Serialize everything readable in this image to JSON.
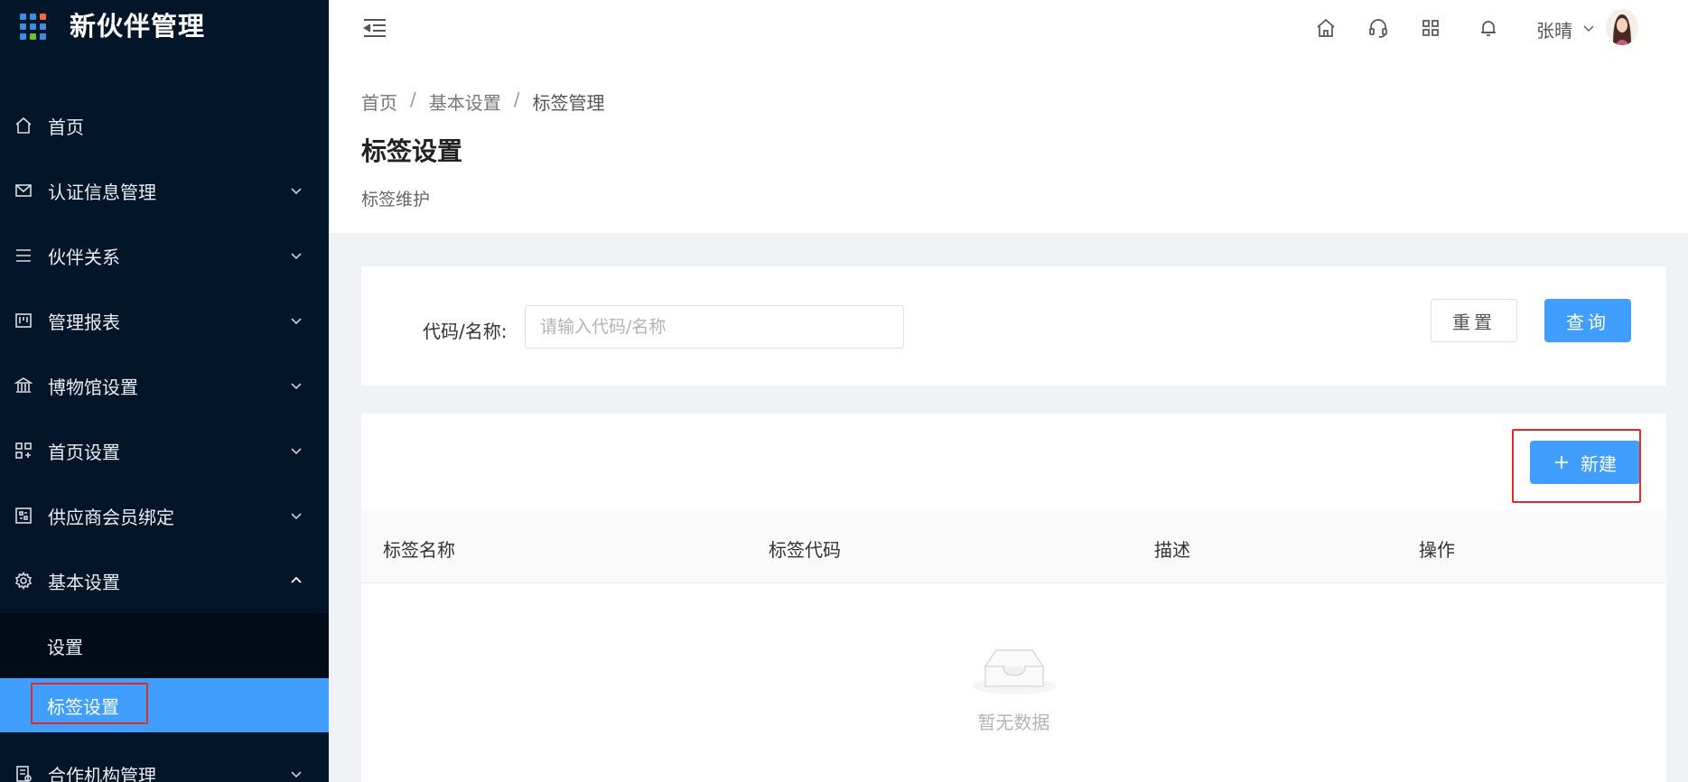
{
  "app": {
    "title": "新伙伴管理",
    "logo_colors": [
      "#3a8ee6",
      "#3a8ee6",
      "#f56c3b",
      "#3a8ee6",
      "#3a8ee6",
      "#3a8ee6",
      "#3a8ee6",
      "#67c23a",
      "#3a8ee6"
    ]
  },
  "sidebar": {
    "items": [
      {
        "label": "首页",
        "icon": "home-icon",
        "has_children": false
      },
      {
        "label": "认证信息管理",
        "icon": "mail-icon",
        "has_children": true
      },
      {
        "label": "伙伴关系",
        "icon": "list-icon",
        "has_children": true
      },
      {
        "label": "管理报表",
        "icon": "report-icon",
        "has_children": true
      },
      {
        "label": "博物馆设置",
        "icon": "museum-icon",
        "has_children": true
      },
      {
        "label": "首页设置",
        "icon": "apps-icon",
        "has_children": true
      },
      {
        "label": "供应商会员绑定",
        "icon": "bind-icon",
        "has_children": true
      },
      {
        "label": "基本设置",
        "icon": "gear-icon",
        "has_children": true,
        "expanded": true
      },
      {
        "label": "合作机构管理",
        "icon": "doc-icon",
        "has_children": true
      }
    ],
    "submenu": [
      {
        "label": "设置",
        "active": false
      },
      {
        "label": "标签设置",
        "active": true
      }
    ],
    "accent_color": "#409eff"
  },
  "header": {
    "user_name": "张晴",
    "icons": [
      "home-icon",
      "headset-icon",
      "grid-icon",
      "bell-icon"
    ]
  },
  "breadcrumb": [
    "首页",
    "基本设置",
    "标签管理"
  ],
  "page": {
    "title": "标签设置",
    "description": "标签维护"
  },
  "search": {
    "label": "代码/名称:",
    "placeholder": "请输入代码/名称",
    "value": "",
    "reset_label": "重置",
    "query_label": "查询"
  },
  "table": {
    "new_label": "新建",
    "columns": [
      "标签名称",
      "标签代码",
      "描述",
      "操作"
    ],
    "rows": [],
    "empty_text": "暂无数据"
  }
}
